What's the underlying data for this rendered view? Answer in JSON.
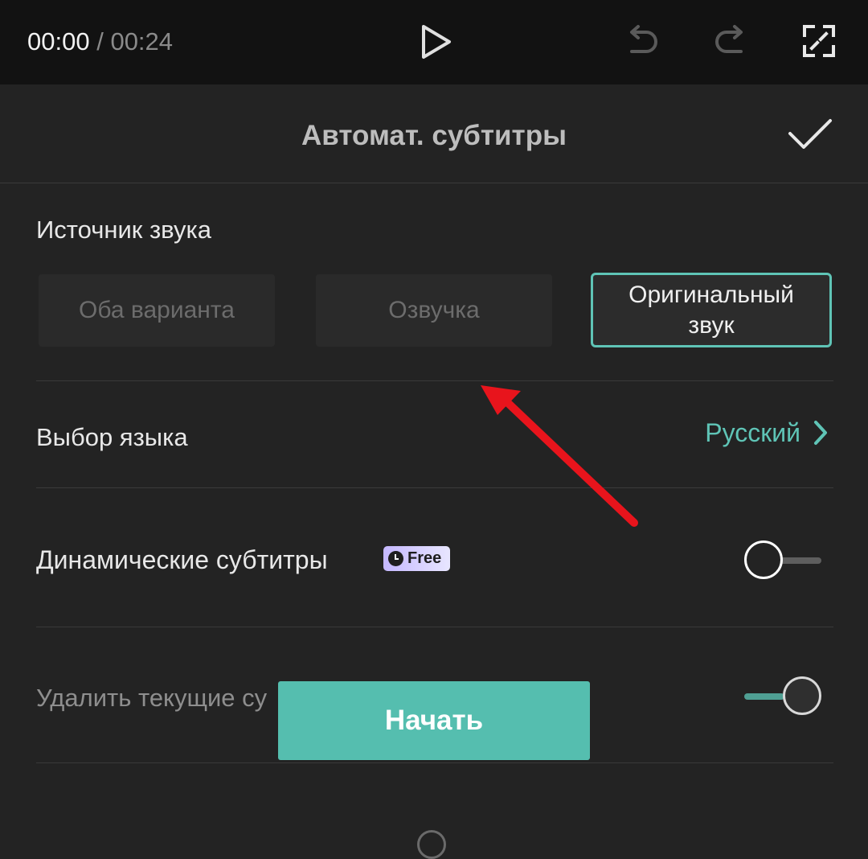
{
  "player": {
    "current_time": "00:00",
    "separator": "/",
    "total_time": "00:24",
    "icons": [
      "play-icon",
      "undo-icon",
      "redo-icon",
      "fullscreen-icon"
    ]
  },
  "panel": {
    "title": "Автомат. субтитры",
    "confirm_icon": "check-icon"
  },
  "audio_source": {
    "label": "Источник звука",
    "options": [
      {
        "label": "Оба варианта",
        "selected": false
      },
      {
        "label": "Озвучка",
        "selected": false
      },
      {
        "label": "Оригинальный звук",
        "selected": true
      }
    ]
  },
  "language": {
    "label": "Выбор языка",
    "value": "Русский",
    "icon": "chevron-right-icon"
  },
  "dynamic_subtitles": {
    "label": "Динамические субтитры",
    "badge": "Free",
    "enabled": false
  },
  "delete_current": {
    "label": "Удалить текущие су",
    "enabled": true
  },
  "start_button": {
    "label": "Начать"
  },
  "colors": {
    "accent": "#5fc4b6",
    "button": "#55beaf",
    "annotation_arrow": "#e8141c"
  }
}
